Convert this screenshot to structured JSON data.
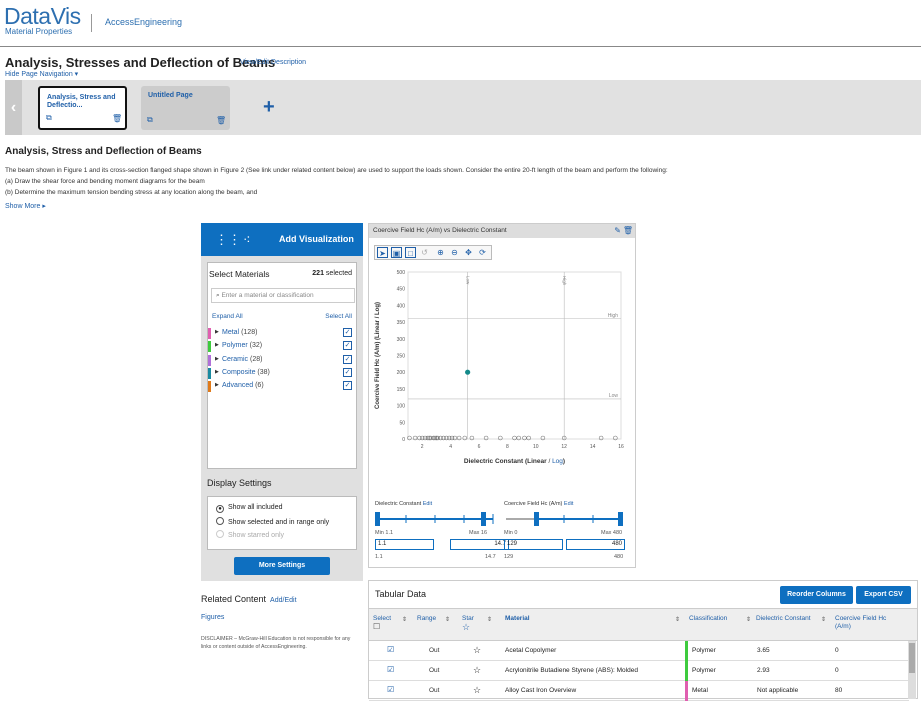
{
  "header": {
    "logo_main": "DataVis",
    "logo_sub": "Material Properties",
    "partner": "AccessEngineering"
  },
  "page": {
    "title": "Analysis, Stresses and Deflection of Beams",
    "edit_link": "View/Edit Description",
    "hide_nav": "Hide Page Navigation"
  },
  "page_tabs": [
    {
      "label": "Analysis, Stress and Deflectio..."
    },
    {
      "label": "Untitled Page"
    }
  ],
  "section": {
    "title": "Analysis, Stress and Deflection of Beams",
    "lines": [
      "The beam shown in Figure 1 and its cross-section flanged shape shown in Figure 2 (See link under related content below) are used to support the loads shown. Consider the entire 20-ft length of the beam and perform the following:",
      "(a)   Draw the shear force and bending moment diagrams for the beam",
      "(b)   Determine the maximum tension bending stress at any location along the beam, and"
    ],
    "show_more": "Show More"
  },
  "left_panel": {
    "add_viz": "Add Visualization",
    "select_materials": "Select Materials",
    "selected_count": "221",
    "selected_word": "selected",
    "search_placeholder": "Enter a material or classification",
    "expand_all": "Expand All",
    "select_all": "Select All",
    "materials": [
      {
        "name": "Metal",
        "count": "(128)",
        "color": "#e05fb0"
      },
      {
        "name": "Polymer",
        "count": "(32)",
        "color": "#3ecb3e"
      },
      {
        "name": "Ceramic",
        "count": "(28)",
        "color": "#b070d8"
      },
      {
        "name": "Composite",
        "count": "(38)",
        "color": "#1a8aa0"
      },
      {
        "name": "Advanced",
        "count": "(6)",
        "color": "#e07a1a"
      }
    ],
    "display_settings": "Display Settings",
    "radio": [
      "Show all included",
      "Show selected and in range only",
      "Show starred only"
    ],
    "more_settings": "More Settings",
    "related": "Related Content",
    "related_edit": "Add/Edit",
    "figures": "Figures",
    "disclaimer": "DISCLAIMER – McGraw-Hill Education is not responsible for any links or content outside of AccessEngineering."
  },
  "chart_panel": {
    "title": "Coercive Field Hc (A/m) vs Dielectric Constant",
    "x_range_label": "Dielectric Constant",
    "y_range_label": "Coercive Field Hc (A/m)",
    "edit": "Edit",
    "x_min": "Min 1.1",
    "x_max": "Max 16",
    "y_min": "Min 0",
    "y_max": "Max 480",
    "x_lo": "1.1",
    "x_hi": "14.7",
    "y_lo": "129",
    "y_hi": "480",
    "x_lo2": "1.1",
    "x_hi2": "14.7",
    "y_lo2": "129",
    "y_hi2": "480"
  },
  "chart_data": {
    "type": "scatter",
    "title": "",
    "xlabel": "Dielectric Constant",
    "xscale_opts": [
      "Linear",
      "Log"
    ],
    "ylabel": "Coercive Field Hc (A/m)",
    "yscale_opts": [
      "Linear",
      "Log"
    ],
    "xlim": [
      1,
      16
    ],
    "ylim": [
      0,
      500
    ],
    "xticks": [
      2,
      4,
      6,
      8,
      10,
      12,
      14,
      16
    ],
    "yticks": [
      0,
      50,
      100,
      150,
      200,
      250,
      300,
      350,
      400,
      450,
      500
    ],
    "h_lines": [
      {
        "label": "High",
        "y": 360
      },
      {
        "label": "Low",
        "y": 120
      }
    ],
    "v_lines": [
      {
        "label": "Low",
        "x": 5.2
      },
      {
        "label": "High",
        "x": 12
      }
    ],
    "highlight": {
      "x": 5.2,
      "y": 200
    },
    "points_x": [
      1.1,
      1.5,
      1.8,
      2.0,
      2.2,
      2.4,
      2.5,
      2.6,
      2.8,
      2.9,
      3.0,
      3.1,
      3.3,
      3.5,
      3.7,
      3.9,
      4.1,
      4.3,
      4.6,
      5.0,
      5.5,
      6.5,
      7.5,
      8.5,
      8.8,
      9.2,
      9.5,
      10.5,
      12,
      14.6,
      15.6
    ],
    "grid": false
  },
  "table": {
    "title": "Tabular Data",
    "reorder": "Reorder Columns",
    "export": "Export CSV",
    "columns": [
      "Select",
      "Range",
      "Star",
      "Material",
      "Classification",
      "Dielectric Constant",
      "Coercive Field Hc (A/m)"
    ],
    "rows": [
      {
        "range": "Out",
        "material": "Acetal Copolymer",
        "class": "Polymer",
        "color": "#3ecb3e",
        "dc": "3.65",
        "hc": "0"
      },
      {
        "range": "Out",
        "material": "Acrylonitrile Butadiene Styrene (ABS): Molded",
        "class": "Polymer",
        "color": "#3ecb3e",
        "dc": "2.93",
        "hc": "0"
      },
      {
        "range": "Out",
        "material": "Alloy Cast Iron Overview",
        "class": "Metal",
        "color": "#e05fb0",
        "dc": "Not applicable",
        "hc": "80"
      }
    ]
  }
}
